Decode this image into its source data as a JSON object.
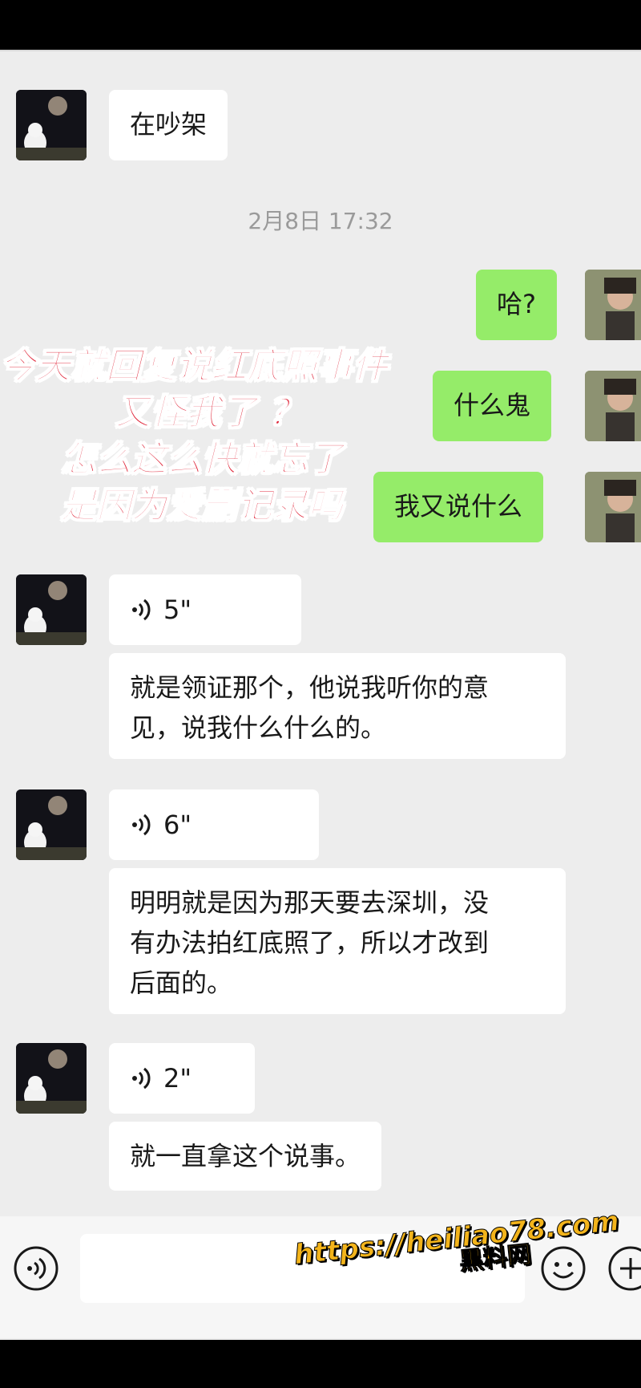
{
  "chat": {
    "timestamp": "2月8日 17:32",
    "messages": [
      {
        "side": "left",
        "type": "text",
        "text": "在吵架"
      },
      {
        "side": "right",
        "type": "text",
        "text": "哈?"
      },
      {
        "side": "right",
        "type": "text",
        "text": "什么鬼"
      },
      {
        "side": "right",
        "type": "text",
        "text": "我又说什么"
      },
      {
        "side": "left",
        "type": "voice",
        "duration": "5\""
      },
      {
        "side": "left",
        "type": "text",
        "text_lines": [
          "就是领证那个，他说我听你的意",
          "见，说我什么什么的。"
        ]
      },
      {
        "side": "left",
        "type": "voice",
        "duration": "6\""
      },
      {
        "side": "left",
        "type": "text",
        "text_lines": [
          "明明就是因为那天要去深圳，没",
          "有办法拍红底照了，所以才改到",
          "后面的。"
        ]
      },
      {
        "side": "left",
        "type": "voice",
        "duration": "2\""
      },
      {
        "side": "left",
        "type": "text",
        "text": "就一直拿这个说事。"
      }
    ]
  },
  "overlay_caption": {
    "lines": [
      "今天就回复说红底照事件",
      "又怪我了 ？",
      "怎么这么快就忘了",
      "是因为爱删记录吗"
    ]
  },
  "input_bar": {
    "icons": [
      "voice-input-icon",
      "emoji-icon",
      "plus-icon"
    ]
  },
  "watermark": {
    "url": "https://heiliao78.com",
    "site": "黑料网"
  },
  "colors": {
    "chat_bg": "#ededed",
    "bubble_self": "#95ec69",
    "bubble_other": "#ffffff",
    "overlay_text": "#e0293c",
    "watermark": "#f3b41b"
  }
}
